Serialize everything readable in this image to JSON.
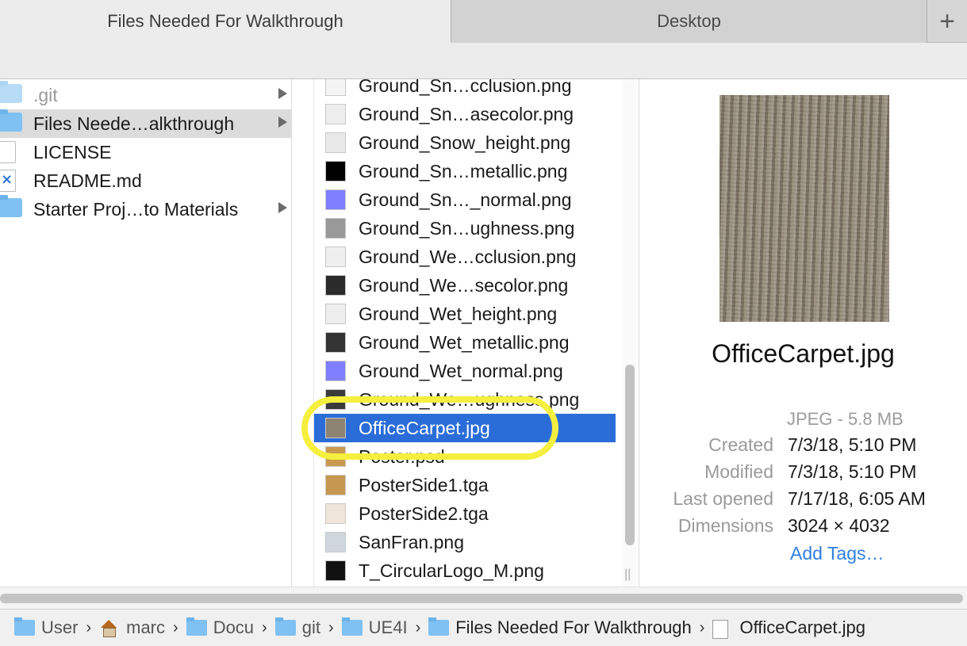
{
  "tabs": [
    {
      "label": "Files Needed For Walkthrough",
      "active": true
    },
    {
      "label": "Desktop",
      "active": false
    }
  ],
  "add_tab_symbol": "+",
  "column1": {
    "items": [
      {
        "label": ".git",
        "icon": "folder-icon",
        "has_children": true,
        "dimmed": true
      },
      {
        "label": "Files Neede…alkthrough",
        "icon": "folder-icon",
        "has_children": true,
        "selected": true
      },
      {
        "label": "LICENSE",
        "icon": "document-icon",
        "has_children": false
      },
      {
        "label": "README.md",
        "icon": "vscode-document-icon",
        "has_children": false
      },
      {
        "label": "Starter Proj…to Materials",
        "icon": "folder-icon",
        "has_children": true
      }
    ]
  },
  "column2": {
    "items": [
      {
        "label": "Ground_Sn…cclusion.png",
        "thumb": "#f4f4f4"
      },
      {
        "label": "Ground_Sn…asecolor.png",
        "thumb": "#ededed"
      },
      {
        "label": "Ground_Snow_height.png",
        "thumb": "#e9e9e9"
      },
      {
        "label": "Ground_Sn…metallic.png",
        "thumb": "#000000"
      },
      {
        "label": "Ground_Sn…_normal.png",
        "thumb": "#7f7fff"
      },
      {
        "label": "Ground_Sn…ughness.png",
        "thumb": "#999999"
      },
      {
        "label": "Ground_We…cclusion.png",
        "thumb": "#efefef"
      },
      {
        "label": "Ground_We…secolor.png",
        "thumb": "#2b2b2b"
      },
      {
        "label": "Ground_Wet_height.png",
        "thumb": "#eeeeee"
      },
      {
        "label": "Ground_Wet_metallic.png",
        "thumb": "#333333"
      },
      {
        "label": "Ground_Wet_normal.png",
        "thumb": "#7f7fff"
      },
      {
        "label": "Ground_We…ughness.png",
        "thumb": "#3a3a3a"
      },
      {
        "label": "OfficeCarpet.jpg",
        "thumb": "#8d8373",
        "selected": true
      },
      {
        "label": "Poster.psd",
        "thumb": "#c99a4e"
      },
      {
        "label": "PosterSide1.tga",
        "thumb": "#c6974e"
      },
      {
        "label": "PosterSide2.tga",
        "thumb": "#efe6d9"
      },
      {
        "label": "SanFran.png",
        "thumb": "#cfd6dc"
      },
      {
        "label": "T_CircularLogo_M.png",
        "thumb": "#111111"
      }
    ]
  },
  "preview": {
    "filename": "OfficeCarpet.jpg",
    "kind": "JPEG - 5.8 MB",
    "meta": [
      {
        "key": "Created",
        "value": "7/3/18, 5:10 PM"
      },
      {
        "key": "Modified",
        "value": "7/3/18, 5:10 PM"
      },
      {
        "key": "Last opened",
        "value": "7/17/18, 6:05 AM"
      },
      {
        "key": "Dimensions",
        "value": "3024 × 4032"
      }
    ],
    "add_tags": "Add Tags…"
  },
  "pathbar": {
    "crumbs": [
      {
        "label": "User",
        "icon": "users-folder-icon"
      },
      {
        "label": "marc",
        "icon": "home-icon"
      },
      {
        "label": "Docu",
        "icon": "documents-folder-icon"
      },
      {
        "label": "git",
        "icon": "folder-icon"
      },
      {
        "label": "UE4I",
        "icon": "folder-icon"
      },
      {
        "label": "Files Needed For Walkthrough",
        "icon": "folder-icon"
      },
      {
        "label": "OfficeCarpet.jpg",
        "icon": "image-file-icon"
      }
    ],
    "separator": "›"
  },
  "colors": {
    "selection": "#2a6dd9",
    "highlight_ring": "#f5ef3f",
    "link": "#2f7fe2",
    "folder": "#7fc1f2"
  }
}
